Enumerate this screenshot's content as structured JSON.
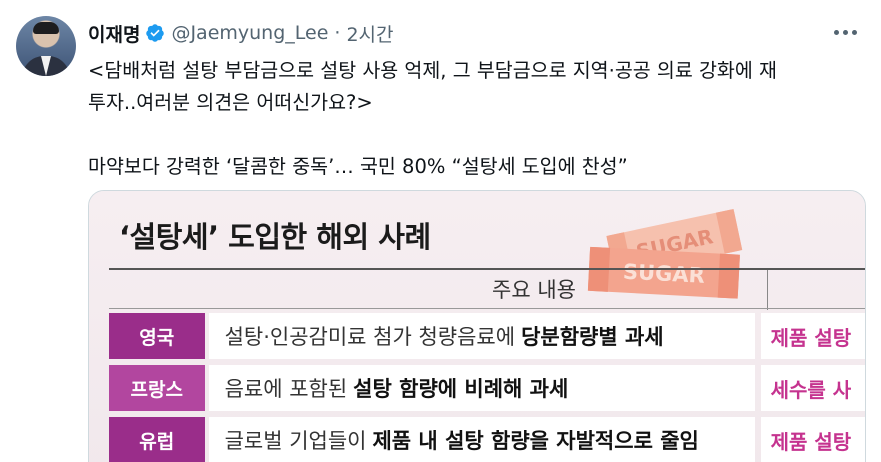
{
  "tweet": {
    "author_name": "이재명",
    "handle": "@Jaemyung_Lee",
    "separator": "·",
    "time": "2시간",
    "lines": [
      "<담배처럼 설탕 부담금으로 설탕 사용 억제, 그 부담금으로 지역·공공 의료 강화에 재",
      "투자..여러분 의견은 어떠신가요?>",
      "마약보다 강력한 ‘달콤한 중독’… 국민 80% “설탕세 도입에 찬성”"
    ]
  },
  "card": {
    "title": "‘설탕세’ 도입한 해외 사례",
    "sticker_text": [
      "SUGAR",
      "SUGAR"
    ],
    "column_header": "주요 내용",
    "rows": [
      {
        "country": "영국",
        "desc_plain": "설탕·인공감미료 첨가 청량음료에",
        "desc_bold": "당분함량별 과세",
        "result": "제품 설탕"
      },
      {
        "country": "프랑스",
        "desc_plain": "음료에 포함된",
        "desc_bold": "설탕 함량에 비례해 과세",
        "result": "세수를 사"
      },
      {
        "country": "유럽",
        "desc_plain": "글로벌 기업들이",
        "desc_bold": "제품 내 설탕 함량을 자발적으로 줄임",
        "result": "제품 설탕"
      }
    ]
  },
  "icons": {
    "verified": "verified-badge-icon",
    "more": "more-options-icon"
  },
  "colors": {
    "verified_badge": "#1d9bf0",
    "country_fill": "#9a2d8a",
    "result_text": "#c5338f",
    "sticker": "#f3a48e"
  }
}
